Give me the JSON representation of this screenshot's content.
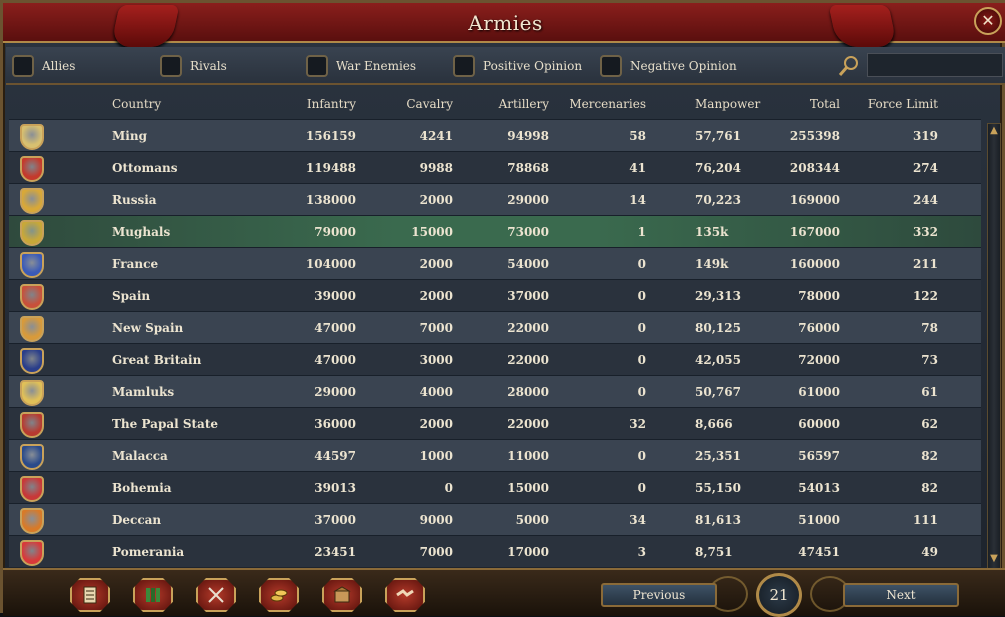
{
  "window": {
    "title": "Armies",
    "close_label": "✕"
  },
  "filters": [
    {
      "label": "Allies"
    },
    {
      "label": "Rivals"
    },
    {
      "label": "War Enemies"
    },
    {
      "label": "Positive Opinion"
    },
    {
      "label": "Negative Opinion"
    }
  ],
  "search": {
    "placeholder": "",
    "value": ""
  },
  "columns": {
    "country": "Country",
    "infantry": "Infantry",
    "cavalry": "Cavalry",
    "artillery": "Artillery",
    "mercenaries": "Mercenaries",
    "manpower": "Manpower",
    "total": "Total",
    "force_limit": "Force Limit"
  },
  "rows": [
    {
      "country": "Ming",
      "infantry": "156159",
      "cavalry": "4241",
      "artillery": "94998",
      "mercenaries": "58",
      "manpower": "57,761",
      "total": "255398",
      "force_limit": "319",
      "shield_color": "#d8c070"
    },
    {
      "country": "Ottomans",
      "infantry": "119488",
      "cavalry": "9988",
      "artillery": "78868",
      "mercenaries": "41",
      "manpower": "76,204",
      "total": "208344",
      "force_limit": "274",
      "shield_color": "#c43a2c"
    },
    {
      "country": "Russia",
      "infantry": "138000",
      "cavalry": "2000",
      "artillery": "29000",
      "mercenaries": "14",
      "manpower": "70,223",
      "total": "169000",
      "force_limit": "244",
      "shield_color": "#d8a838"
    },
    {
      "country": "Mughals",
      "infantry": "79000",
      "cavalry": "15000",
      "artillery": "73000",
      "mercenaries": "1",
      "manpower": "135k",
      "total": "167000",
      "force_limit": "332",
      "shield_color": "#c8a838"
    },
    {
      "country": "France",
      "infantry": "104000",
      "cavalry": "2000",
      "artillery": "54000",
      "mercenaries": "0",
      "manpower": "149k",
      "total": "160000",
      "force_limit": "211",
      "shield_color": "#3a5ab8"
    },
    {
      "country": "Spain",
      "infantry": "39000",
      "cavalry": "2000",
      "artillery": "37000",
      "mercenaries": "0",
      "manpower": "29,313",
      "total": "78000",
      "force_limit": "122",
      "shield_color": "#c8503a"
    },
    {
      "country": "New Spain",
      "infantry": "47000",
      "cavalry": "7000",
      "artillery": "22000",
      "mercenaries": "0",
      "manpower": "80,125",
      "total": "76000",
      "force_limit": "78",
      "shield_color": "#d89a3a"
    },
    {
      "country": "Great Britain",
      "infantry": "47000",
      "cavalry": "3000",
      "artillery": "22000",
      "mercenaries": "0",
      "manpower": "42,055",
      "total": "72000",
      "force_limit": "73",
      "shield_color": "#2a3e8a"
    },
    {
      "country": "Mamluks",
      "infantry": "29000",
      "cavalry": "4000",
      "artillery": "28000",
      "mercenaries": "0",
      "manpower": "50,767",
      "total": "61000",
      "force_limit": "61",
      "shield_color": "#e0c058"
    },
    {
      "country": "The Papal State",
      "infantry": "36000",
      "cavalry": "2000",
      "artillery": "22000",
      "mercenaries": "32",
      "manpower": "8,666",
      "total": "60000",
      "force_limit": "62",
      "shield_color": "#b83a30"
    },
    {
      "country": "Malacca",
      "infantry": "44597",
      "cavalry": "1000",
      "artillery": "11000",
      "mercenaries": "0",
      "manpower": "25,351",
      "total": "56597",
      "force_limit": "82",
      "shield_color": "#2a4a8a"
    },
    {
      "country": "Bohemia",
      "infantry": "39013",
      "cavalry": "0",
      "artillery": "15000",
      "mercenaries": "0",
      "manpower": "55,150",
      "total": "54013",
      "force_limit": "82",
      "shield_color": "#c83838"
    },
    {
      "country": "Deccan",
      "infantry": "37000",
      "cavalry": "9000",
      "artillery": "5000",
      "mercenaries": "34",
      "manpower": "81,613",
      "total": "51000",
      "force_limit": "111",
      "shield_color": "#d87a28"
    },
    {
      "country": "Pomerania",
      "infantry": "23451",
      "cavalry": "7000",
      "artillery": "17000",
      "mercenaries": "3",
      "manpower": "8,751",
      "total": "47451",
      "force_limit": "49",
      "shield_color": "#d83a3a"
    }
  ],
  "highlighted_row": "Mughals",
  "toolbar": [
    {
      "icon": "ledger-icon"
    },
    {
      "icon": "flags-icon"
    },
    {
      "icon": "crossed-swords-icon"
    },
    {
      "icon": "coins-icon"
    },
    {
      "icon": "trade-goods-icon"
    },
    {
      "icon": "handshake-icon"
    }
  ],
  "pagination": {
    "previous_label": "Previous",
    "next_label": "Next",
    "page": "21"
  },
  "colors": {
    "accent_gold": "#c9a25a",
    "title_red": "#8a1f1c",
    "highlight_green": "#3a6a4e"
  }
}
